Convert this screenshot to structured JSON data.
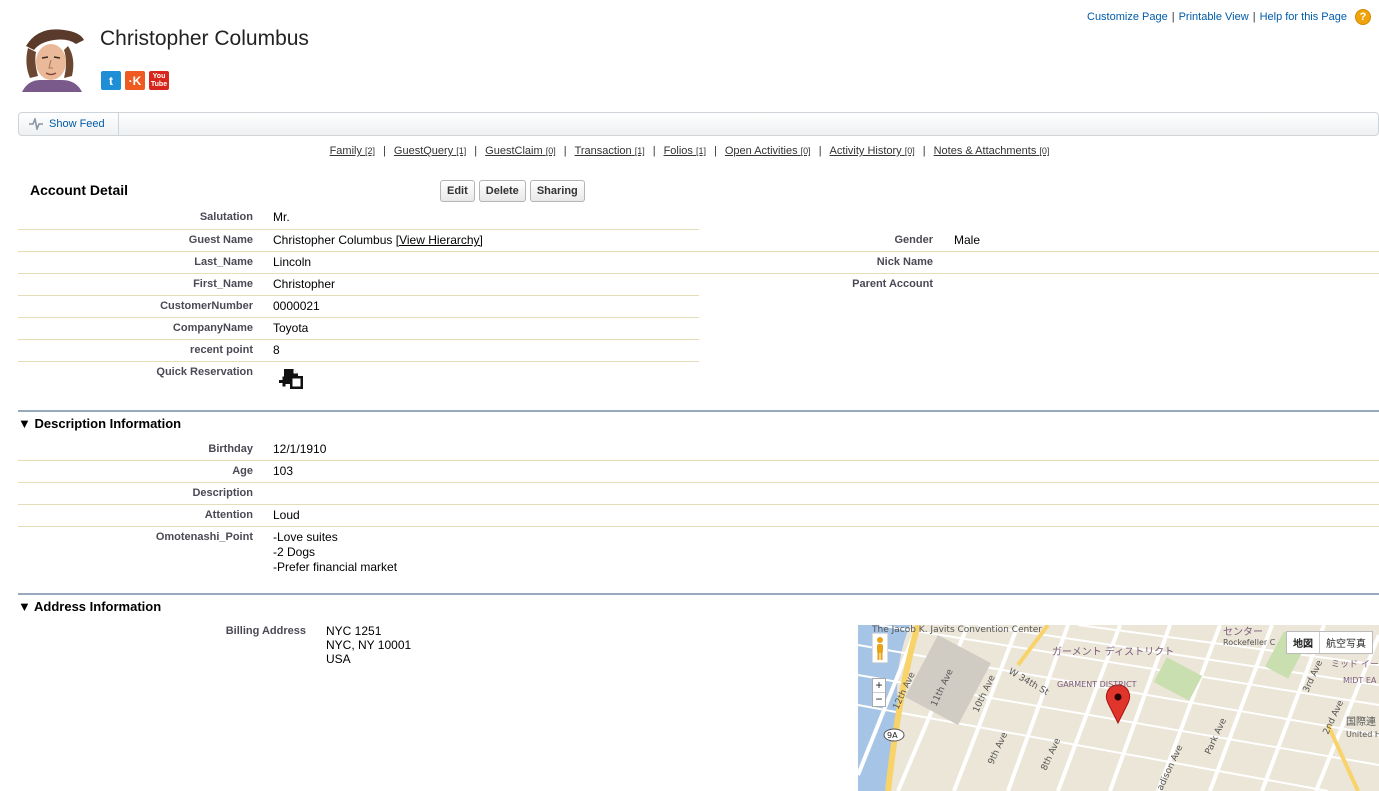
{
  "top_links": {
    "customize": "Customize Page",
    "printable": "Printable View",
    "help": "Help for this Page",
    "separator": "|",
    "help_icon_glyph": "?"
  },
  "header": {
    "title": "Christopher Columbus",
    "social": {
      "twitter": "t",
      "klout": "·K",
      "youtube_top": "You",
      "youtube_bottom": "Tube"
    }
  },
  "feed": {
    "label": "Show Feed"
  },
  "related_links": [
    {
      "label": "Family",
      "count": "[2]"
    },
    {
      "label": "GuestQuery",
      "count": "[1]"
    },
    {
      "label": "GuestClaim",
      "count": "[0]"
    },
    {
      "label": "Transaction",
      "count": "[1]"
    },
    {
      "label": "Folios",
      "count": "[1]"
    },
    {
      "label": "Open Activities",
      "count": "[0]"
    },
    {
      "label": "Activity History",
      "count": "[0]"
    },
    {
      "label": "Notes & Attachments",
      "count": "[0]"
    }
  ],
  "account_detail": {
    "title": "Account Detail",
    "buttons": {
      "edit": "Edit",
      "delete": "Delete",
      "sharing": "Sharing"
    },
    "left_fields": [
      {
        "label": "Salutation",
        "value": "Mr."
      },
      {
        "label": "Guest Name",
        "value": "Christopher Columbus",
        "link": "[View Hierarchy]"
      },
      {
        "label": "Last_Name",
        "value": "Lincoln"
      },
      {
        "label": "First_Name",
        "value": "Christopher"
      },
      {
        "label": "CustomerNumber",
        "value": "0000021"
      },
      {
        "label": "CompanyName",
        "value": "Toyota"
      },
      {
        "label": "recent point",
        "value": "8"
      },
      {
        "label": "Quick Reservation",
        "value": ""
      }
    ],
    "right_fields": [
      {
        "label": "Gender",
        "value": "Male"
      },
      {
        "label": "Nick Name",
        "value": ""
      },
      {
        "label": "Parent Account",
        "value": ""
      }
    ]
  },
  "description": {
    "title": "Description Information",
    "fields": [
      {
        "label": "Birthday",
        "value": "12/1/1910"
      },
      {
        "label": "Age",
        "value": "103"
      },
      {
        "label": "Description",
        "value": ""
      },
      {
        "label": "Attention",
        "value": "Loud"
      },
      {
        "label": "Omotenashi_Point",
        "lines": [
          "-Love suites",
          "-2 Dogs",
          "-Prefer financial market"
        ]
      }
    ]
  },
  "address": {
    "title": "Address Information",
    "billing_label": "Billing Address",
    "billing_lines": [
      "NYC 1251",
      "NYC, NY 10001",
      "USA"
    ]
  },
  "map": {
    "type_map": "地図",
    "type_satellite": "航空写真",
    "zoom_in": "+",
    "zoom_out": "−",
    "labels": {
      "javits": "The Jacob K. Javits Convention Center",
      "garment_jp": "ガーメント ディストリクト",
      "garment_en": "GARMENT DISTRICT",
      "center": "センター",
      "rockefeller": "Rockefeller C",
      "midtown_jp": "ミッド イー",
      "midtown_en": "MIDT EA",
      "un_jp": "国際連",
      "un_en": "United Headqu",
      "ave12": "12th Ave",
      "ave11": "11th Ave",
      "ave10": "10th Ave",
      "ave9": "9th Ave",
      "ave8": "8th Ave",
      "w34": "W 34th St",
      "madison": "adison Ave",
      "park": "Park Ave",
      "ave3": "3rd Ave",
      "ave2": "2nd Ave",
      "route": "9A"
    },
    "colors": {
      "water": "#a5c4e6",
      "road_major": "#f8d36a",
      "pin": "#e0352b"
    }
  }
}
